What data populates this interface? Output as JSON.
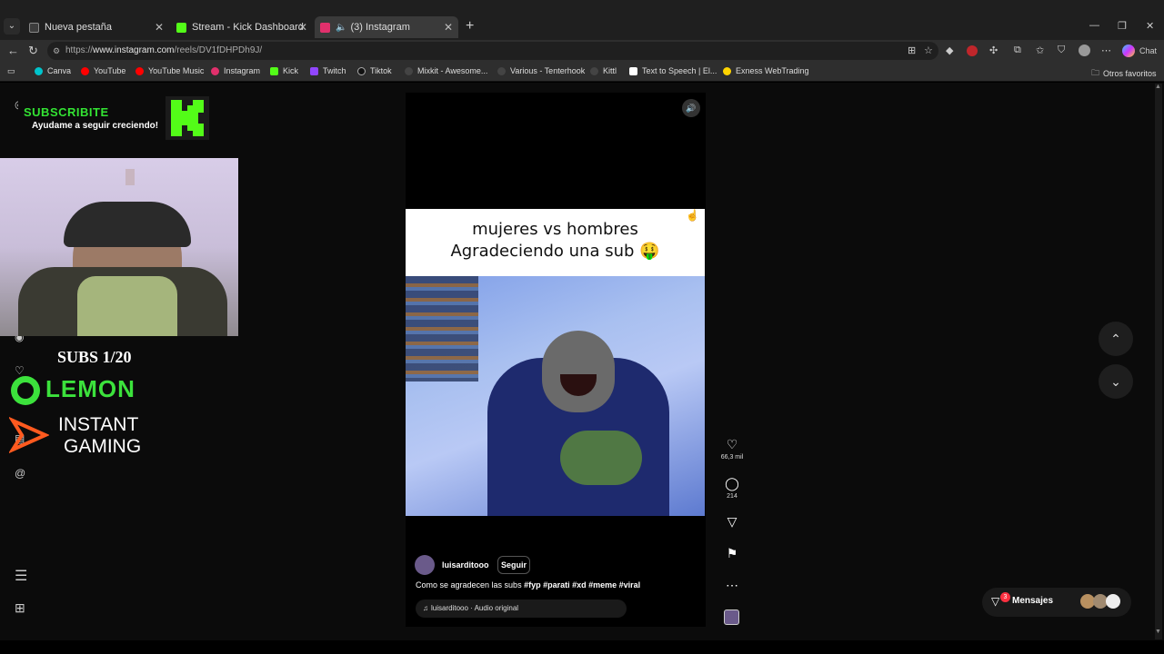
{
  "browser": {
    "tabs": [
      {
        "label": "Nueva pestaña",
        "favicon_color": "#3c3c3c"
      },
      {
        "label": "Stream - Kick Dashboard",
        "favicon_color": "#53fc18"
      },
      {
        "label": "(3) Instagram",
        "favicon_color": "#e1306c"
      }
    ],
    "url_prefix": "https://",
    "url_host": "www.instagram.com",
    "url_path": "/reels/DV1fDHPDh9J/",
    "chat_label": "Chat",
    "bookmarks": [
      {
        "label": "Canva",
        "color": "#00c4cc"
      },
      {
        "label": "YouTube",
        "color": "#ff0000"
      },
      {
        "label": "YouTube Music",
        "color": "#ff0000"
      },
      {
        "label": "Instagram",
        "color": "#e1306c"
      },
      {
        "label": "Kick",
        "color": "#53fc18"
      },
      {
        "label": "Twitch",
        "color": "#9146ff"
      },
      {
        "label": "Tiktok",
        "color": "#111111"
      },
      {
        "label": "Mixkit - Awesome...",
        "color": "#222222"
      },
      {
        "label": "Various - Tenterhook",
        "color": "#222222"
      },
      {
        "label": "Kittl",
        "color": "#222222"
      },
      {
        "label": "Text to Speech | El...",
        "color": "#ffffff"
      },
      {
        "label": "Exness WebTrading",
        "color": "#ffd400"
      }
    ],
    "other_favorites": "Otros favoritos"
  },
  "overlay": {
    "subscribe_title": "SUBSCRIBITE",
    "subscribe_sub": "Ayudame a seguir creciendo!",
    "subs_count": "SUBS 1/20",
    "lemon": "LEMON",
    "instant_line1": "INSTANT",
    "instant_line2": "GAMING"
  },
  "reel": {
    "caption_line1": "mujeres vs hombres",
    "caption_line2": "Agradeciendo una sub 🤑",
    "username": "luisarditooo",
    "follow": "Seguir",
    "description": "Como se agradecen las subs",
    "hashtags": "#fyp #parati #xd #meme #viral",
    "audio": "luisarditooo · Audio original",
    "likes": "66,3 mil",
    "comments": "214"
  },
  "messages": {
    "label": "Mensajes",
    "badge": "3"
  },
  "colors": {
    "accent_green": "#53fc18",
    "instagram_pink": "#e1306c",
    "badge_red": "#ff3040"
  }
}
